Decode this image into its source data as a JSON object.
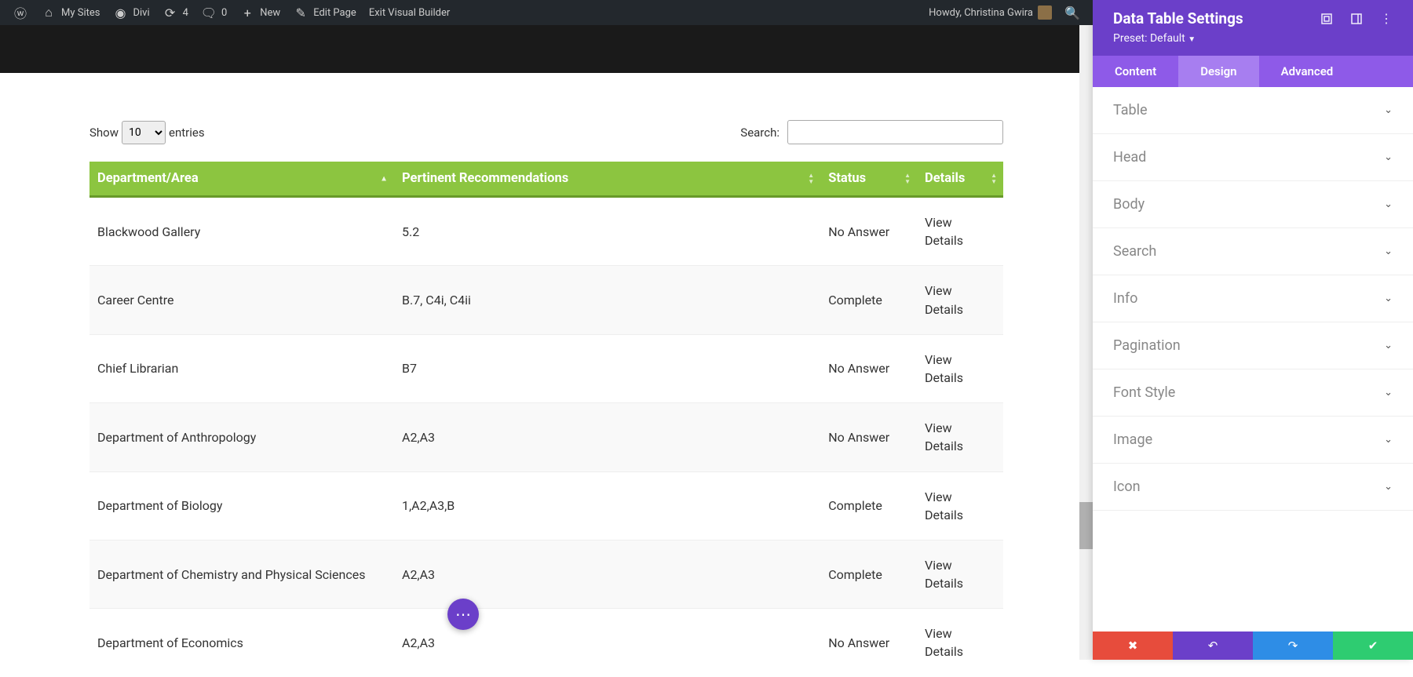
{
  "adminBar": {
    "mySites": "My Sites",
    "divi": "Divi",
    "updates": "4",
    "comments": "0",
    "new": "New",
    "editPage": "Edit Page",
    "exitVB": "Exit Visual Builder",
    "howdy": "Howdy, Christina Gwira"
  },
  "tableControls": {
    "showLabel": "Show",
    "entriesLabel": "entries",
    "entriesValue": "10",
    "searchLabel": "Search:"
  },
  "columns": {
    "dept": "Department/Area",
    "rec": "Pertinent Recommendations",
    "status": "Status",
    "details": "Details"
  },
  "rows": [
    {
      "dept": "Blackwood Gallery",
      "rec": "5.2",
      "status": "No Answer",
      "details": "View Details"
    },
    {
      "dept": "Career Centre",
      "rec": "B.7, C4i, C4ii",
      "status": "Complete",
      "details": "View Details"
    },
    {
      "dept": "Chief Librarian",
      "rec": "B7",
      "status": "No Answer",
      "details": "View Details"
    },
    {
      "dept": "Department of Anthropology",
      "rec": "A2,A3",
      "status": "No Answer",
      "details": "View Details"
    },
    {
      "dept": "Department of Biology",
      "rec": "1,A2,A3,B",
      "status": "Complete",
      "details": "View Details"
    },
    {
      "dept": "Department of Chemistry and Physical Sciences",
      "rec": "A2,A3",
      "status": "Complete",
      "details": "View Details"
    },
    {
      "dept": "Department of Economics",
      "rec": "A2,A3",
      "status": "No Answer",
      "details": "View Details"
    }
  ],
  "settings": {
    "title": "Data Table Settings",
    "preset": "Preset: Default",
    "tabs": {
      "content": "Content",
      "design": "Design",
      "advanced": "Advanced"
    },
    "sections": [
      "Table",
      "Head",
      "Body",
      "Search",
      "Info",
      "Pagination",
      "Font Style",
      "Image",
      "Icon"
    ]
  }
}
